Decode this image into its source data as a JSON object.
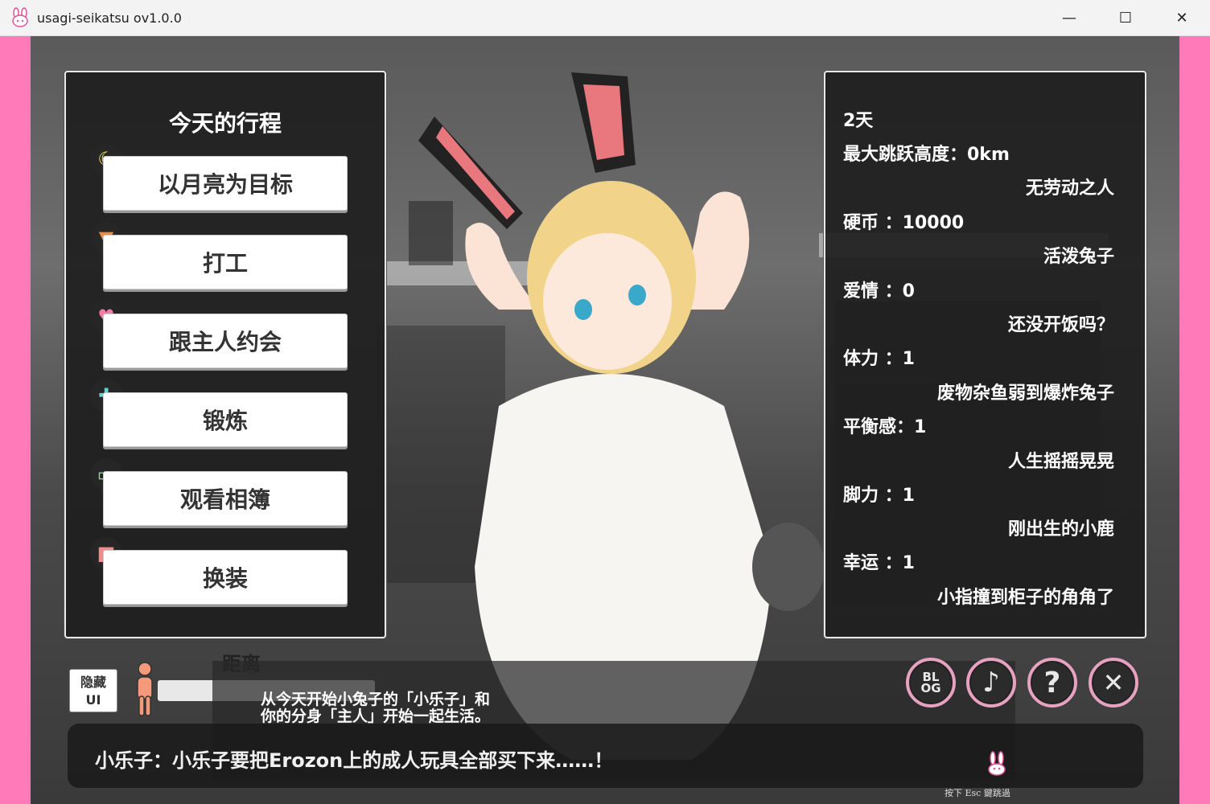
{
  "window": {
    "title": "usagi-seikatsu ov1.0.0",
    "minimize": "—",
    "maximize": "☐",
    "close": "✕"
  },
  "schedule": {
    "title": "今天的行程",
    "actions": [
      {
        "label": "以月亮为目标",
        "icon": "moon-icon",
        "glyph": "☾",
        "color": "#f6e24a"
      },
      {
        "label": "打工",
        "icon": "carrot-icon",
        "glyph": "🥕",
        "color": "#f08a3c"
      },
      {
        "label": "跟主人约会",
        "icon": "heart-icon",
        "glyph": "♥",
        "color": "#f47aa8"
      },
      {
        "label": "锻炼",
        "icon": "dumbbell-icon",
        "glyph": "⚕",
        "color": "#5fd6d6"
      },
      {
        "label": "观看相簿",
        "icon": "book-icon",
        "glyph": "📖",
        "color": "#8ee08a"
      },
      {
        "label": "换装",
        "icon": "shirt-icon",
        "glyph": "👕",
        "color": "#f58a8a"
      }
    ]
  },
  "stats": {
    "day": "2天",
    "max_jump": "最大跳跃高度：0km",
    "max_jump_desc": "无劳动之人",
    "coins": "硬币 ：10000",
    "coins_desc": "活泼兔子",
    "love": "爱情 ：0",
    "love_desc": "还没开饭吗？",
    "stamina": "体力 ：1",
    "stamina_desc": "废物杂鱼弱到爆炸兔子",
    "balance": "平衡感：1",
    "balance_desc": "人生摇摇晃晃",
    "leg": "脚力 ：1",
    "leg_desc": "刚出生的小鹿",
    "luck": "幸运 ：1",
    "luck_desc": "小指撞到柜子的角角了"
  },
  "bottom": {
    "hide_ui_line1": "隐藏",
    "hide_ui_line2": "UI",
    "distance_label": "距离",
    "intro": "从今天开始小兔子的「小乐子」和\n你的分身「主人」开始一起生活。",
    "dialog": "小乐子：小乐子要把Erozon上的成人玩具全部买下来……！",
    "skip_hint": "按下 Esc 鍵跳過",
    "blog": "BL\nOG",
    "music": "♪",
    "help": "?",
    "close": "✕"
  },
  "colors": {
    "frame_pink": "#ff7ab8",
    "panel_bg": "#1e1e1e",
    "button_ring": "#e6a2c0"
  }
}
